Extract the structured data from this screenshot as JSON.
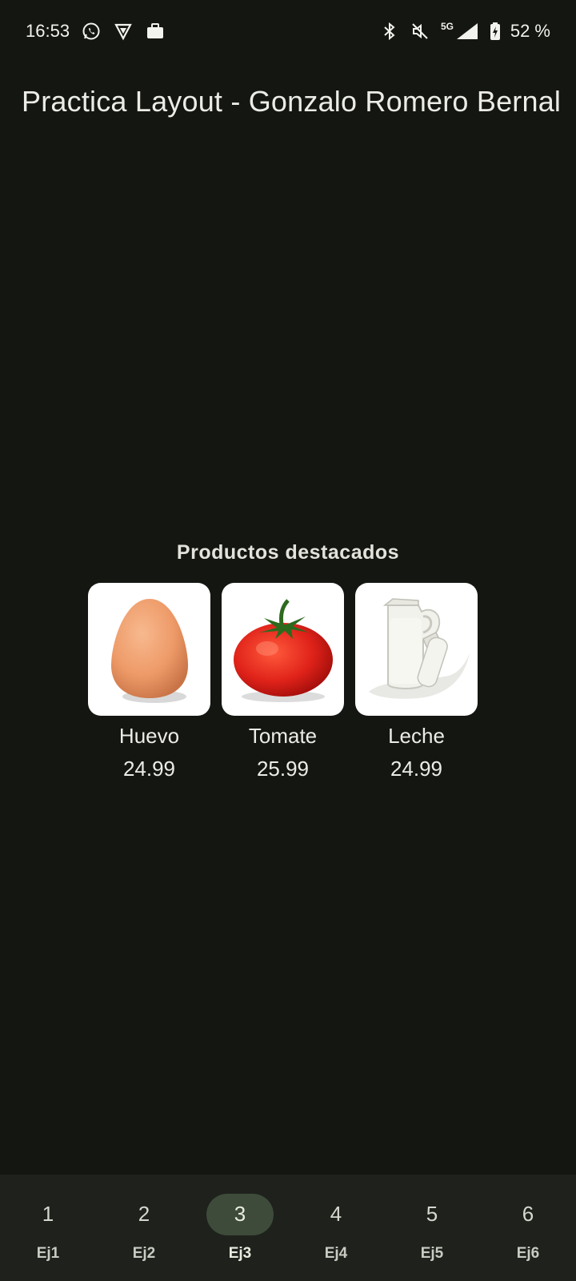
{
  "status_bar": {
    "time": "16:53",
    "left_icons": [
      "whatsapp-icon",
      "vpn-shield-icon",
      "work-briefcase-icon"
    ],
    "right_icons": [
      "bluetooth-icon",
      "mute-icon",
      "5g-signal-icon",
      "battery-charging-icon"
    ],
    "network": "5G",
    "battery": "52 %"
  },
  "app": {
    "title": "Practica Layout - Gonzalo Romero Bernal"
  },
  "section": {
    "title": "Productos destacados"
  },
  "products": [
    {
      "name": "Huevo",
      "price": "24.99",
      "icon": "egg-image"
    },
    {
      "name": "Tomate",
      "price": "25.99",
      "icon": "tomato-image"
    },
    {
      "name": "Leche",
      "price": "24.99",
      "icon": "milk-image"
    }
  ],
  "nav": {
    "items": [
      {
        "number": "1",
        "label": "Ej1"
      },
      {
        "number": "2",
        "label": "Ej2"
      },
      {
        "number": "3",
        "label": "Ej3"
      },
      {
        "number": "4",
        "label": "Ej4"
      },
      {
        "number": "5",
        "label": "Ej5"
      },
      {
        "number": "6",
        "label": "Ej6"
      }
    ],
    "active_index": 2
  },
  "colors": {
    "background": "#141612",
    "nav_background": "#1e211c",
    "active_pill": "#3e4b3a"
  }
}
